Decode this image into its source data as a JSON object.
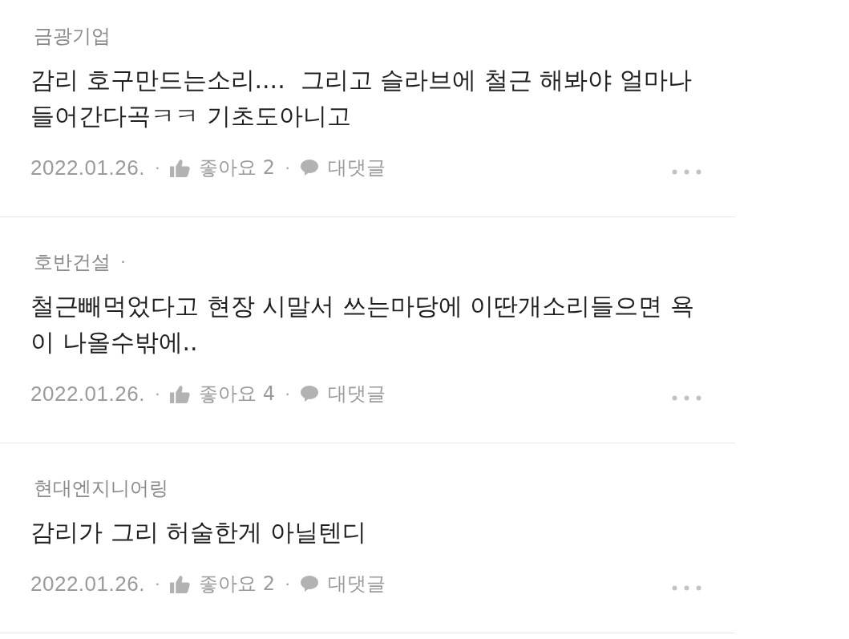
{
  "comments": [
    {
      "author": "금광기업",
      "text": "감리 호구만드는소리....  그리고 슬라브에 철근 해봐야 얼마나 들어간다곡ㅋㅋ 기초도아니고",
      "meta": [
        {
          "kind": "date",
          "text": "2022.01.26."
        },
        {
          "kind": "separator",
          "text": "·"
        },
        {
          "kind": "like",
          "text": "좋아요 2"
        },
        {
          "kind": "separator",
          "text": "·"
        },
        {
          "kind": "reply",
          "text": "대댓글"
        }
      ]
    },
    {
      "author": "호반건설",
      "author_mark": "·",
      "text": "철근빼먹었다고 현장 시말서 쓰는마당에 이딴개소리들으면 욕이 나올수밖에..",
      "meta": [
        {
          "kind": "date",
          "text": "2022.01.26."
        },
        {
          "kind": "separator",
          "text": "·"
        },
        {
          "kind": "like",
          "text": "좋아요 4"
        },
        {
          "kind": "separator",
          "text": "·"
        },
        {
          "kind": "reply",
          "text": "대댓글"
        }
      ]
    },
    {
      "author": "현대엔지니어링",
      "text": "감리가 그리 허술한게 아닐텐디",
      "meta": [
        {
          "kind": "date",
          "text": "2022.01.26."
        },
        {
          "kind": "separator",
          "text": "·"
        },
        {
          "kind": "like",
          "text": "좋아요 2"
        },
        {
          "kind": "separator",
          "text": "·"
        },
        {
          "kind": "reply",
          "text": "대댓글"
        }
      ]
    }
  ]
}
